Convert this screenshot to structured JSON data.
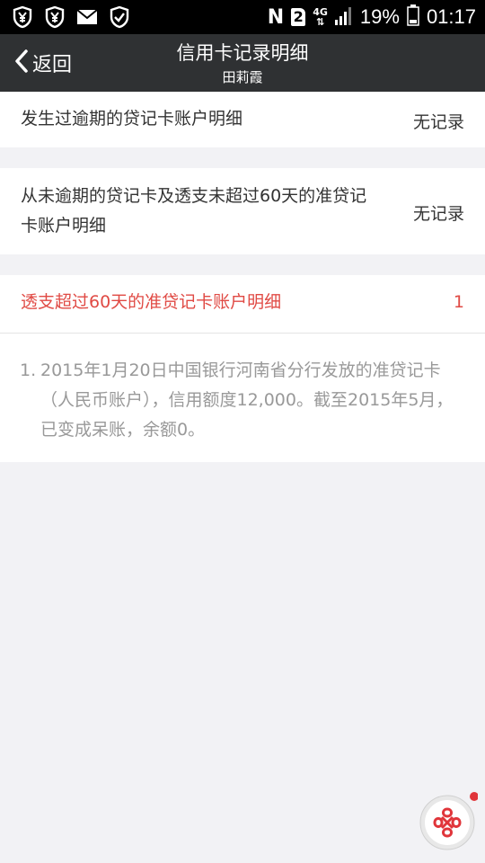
{
  "status_bar": {
    "carrier": "N",
    "sim": "2",
    "network": "4G",
    "battery": "19%",
    "time": "01:17"
  },
  "nav": {
    "back_label": "返回",
    "title": "信用卡记录明细",
    "subtitle": "田莉霞"
  },
  "rows": [
    {
      "label": "发生过逾期的贷记卡账户明细",
      "value": "无记录"
    },
    {
      "label": "从未逾期的贷记卡及透支未超过60天的准贷记卡账户明细",
      "value": "无记录"
    },
    {
      "label": "透支超过60天的准贷记卡账户明细",
      "value": "1"
    }
  ],
  "details": [
    {
      "num": "1.",
      "text": "2015年1月20日中国银行河南省分行发放的准贷记卡（人民币账户），信用额度12,000。截至2015年5月，已变成呆账，余额0。"
    }
  ],
  "colors": {
    "nav_bg": "#2f3133",
    "accent_red": "#e04a44",
    "page_bg": "#f2f2f5"
  }
}
